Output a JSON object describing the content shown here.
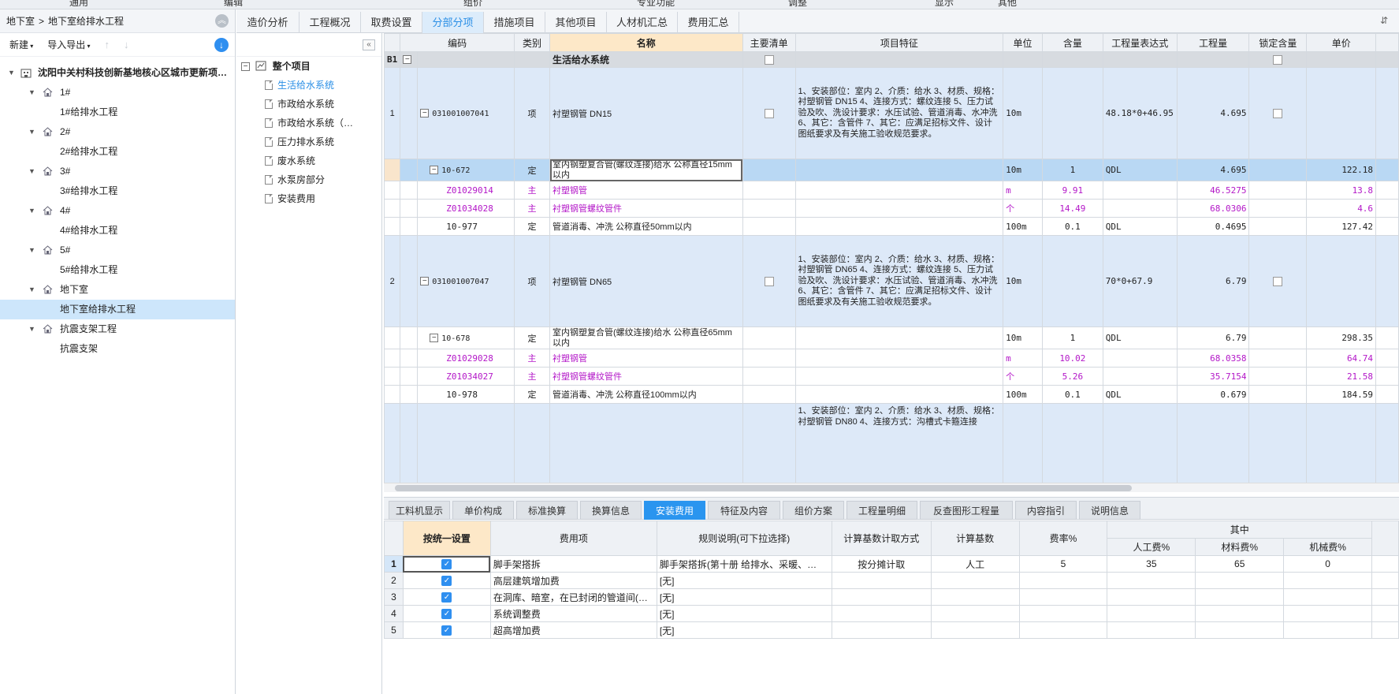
{
  "ribbon": {
    "items": [
      "通用",
      "编辑",
      "组价",
      "专业功能",
      "调整",
      "显示",
      "其他"
    ]
  },
  "breadcrumb": {
    "root": "地下室",
    "sep": ">",
    "current": "地下室给排水工程"
  },
  "toolbar": {
    "new_label": "新建",
    "import_label": "导入导出"
  },
  "project_tree": {
    "project": "沈阳中关村科技创新基地核心区城市更新项…",
    "items": [
      {
        "label": "1#",
        "child": "1#给排水工程"
      },
      {
        "label": "2#",
        "child": "2#给排水工程"
      },
      {
        "label": "3#",
        "child": "3#给排水工程"
      },
      {
        "label": "4#",
        "child": "4#给排水工程"
      },
      {
        "label": "5#",
        "child": "5#给排水工程"
      },
      {
        "label": "地下室",
        "child": "地下室给排水工程"
      },
      {
        "label": "抗震支架工程",
        "child": "抗震支架"
      }
    ]
  },
  "tabs": [
    "造价分析",
    "工程概况",
    "取费设置",
    "分部分项",
    "措施项目",
    "其他项目",
    "人材机汇总",
    "费用汇总"
  ],
  "section_tree": {
    "root": "整个项目",
    "items": [
      "生活给水系统",
      "市政给水系统",
      "市政给水系统（…",
      "压力排水系统",
      "废水系统",
      "水泵房部分",
      "安装费用"
    ]
  },
  "grid": {
    "headers": [
      "编码",
      "类别",
      "名称",
      "主要清单",
      "项目特征",
      "单位",
      "含量",
      "工程量表达式",
      "工程量",
      "锁定含量",
      "单价"
    ],
    "group": {
      "code": "B1",
      "name": "生活给水系统"
    },
    "rows": [
      {
        "num": "1",
        "code": "031001007041",
        "cat": "项",
        "name": "衬塑钢管 DN15",
        "feature": "1、安装部位：室内\n2、介质：给水\n3、材质、规格：衬塑钢管 DN15\n4、连接方式：螺纹连接\n5、压力试验及吹、洗设计要求：水压试验、管道消毒、水冲洗\n6、其它：含管件\n7、其它：应满足招标文件、设计图纸要求及有关施工验收规范要求。",
        "unit": "10m",
        "qty_expr": "48.18*0+46.95",
        "qty": "4.695"
      },
      {
        "code": "10-672",
        "cat": "定",
        "name": "室内钢塑复合管(螺纹连接)给水 公称直径15mm以内",
        "unit": "10m",
        "ratio": "1",
        "qty_expr": "QDL",
        "qty": "4.695",
        "price": "122.18"
      },
      {
        "code": "Z01029014",
        "cat": "主",
        "name": "衬塑钢管",
        "unit": "m",
        "ratio": "9.91",
        "qty": "46.5275",
        "price": "13.8"
      },
      {
        "code": "Z01034028",
        "cat": "主",
        "name": "衬塑钢管螺纹管件",
        "unit": "个",
        "ratio": "14.49",
        "qty": "68.0306",
        "price": "4.6"
      },
      {
        "code": "10-977",
        "cat": "定",
        "name": "管道消毒、冲洗 公称直径50mm以内",
        "unit": "100m",
        "ratio": "0.1",
        "qty_expr": "QDL",
        "qty": "0.4695",
        "price": "127.42"
      },
      {
        "num": "2",
        "code": "031001007047",
        "cat": "项",
        "name": "衬塑钢管 DN65",
        "feature": "1、安装部位：室内\n2、介质：给水\n3、材质、规格：衬塑钢管 DN65\n4、连接方式：螺纹连接\n5、压力试验及吹、洗设计要求：水压试验、管道消毒、水冲洗\n6、其它：含管件\n7、其它：应满足招标文件、设计图纸要求及有关施工验收规范要求。",
        "unit": "10m",
        "qty_expr": "70*0+67.9",
        "qty": "6.79"
      },
      {
        "code": "10-678",
        "cat": "定",
        "name": "室内钢塑复合管(螺纹连接)给水 公称直径65mm以内",
        "unit": "10m",
        "ratio": "1",
        "qty_expr": "QDL",
        "qty": "6.79",
        "price": "298.35"
      },
      {
        "code": "Z01029028",
        "cat": "主",
        "name": "衬塑钢管",
        "unit": "m",
        "ratio": "10.02",
        "qty": "68.0358",
        "price": "64.74"
      },
      {
        "code": "Z01034027",
        "cat": "主",
        "name": "衬塑钢管螺纹管件",
        "unit": "个",
        "ratio": "5.26",
        "qty": "35.7154",
        "price": "21.58"
      },
      {
        "code": "10-978",
        "cat": "定",
        "name": "管道消毒、冲洗 公称直径100mm以内",
        "unit": "100m",
        "ratio": "0.1",
        "qty_expr": "QDL",
        "qty": "0.679",
        "price": "184.59"
      },
      {
        "feature": "1、安装部位：室内\n2、介质：给水\n3、材质、规格：衬塑钢管 DN80\n4、连接方式：沟槽式卡箍连接"
      }
    ]
  },
  "bottom_tabs": [
    "工料机显示",
    "单价构成",
    "标准换算",
    "换算信息",
    "安装费用",
    "特征及内容",
    "组价方案",
    "工程量明细",
    "反查图形工程量",
    "内容指引",
    "说明信息"
  ],
  "cost_grid": {
    "headers": [
      "按统一设置",
      "费用项",
      "规则说明(可下拉选择)",
      "计算基数计取方式",
      "计算基数",
      "费率%",
      "其中"
    ],
    "sub_headers": [
      "人工费%",
      "材料费%",
      "机械费%"
    ],
    "rows": [
      {
        "n": "1",
        "item": "脚手架搭拆",
        "rule": "脚手架搭拆(第十册 给排水、采暖、…",
        "method": "按分摊计取",
        "base": "人工",
        "rate": "5",
        "labor": "35",
        "material": "65",
        "machine": "0"
      },
      {
        "n": "2",
        "item": "高层建筑增加费",
        "rule": "[无]"
      },
      {
        "n": "3",
        "item": "在洞库、暗室，在已封闭的管道间(…",
        "rule": "[无]"
      },
      {
        "n": "4",
        "item": "系统调整费",
        "rule": "[无]"
      },
      {
        "n": "5",
        "item": "超高增加费",
        "rule": "[无]"
      }
    ]
  }
}
